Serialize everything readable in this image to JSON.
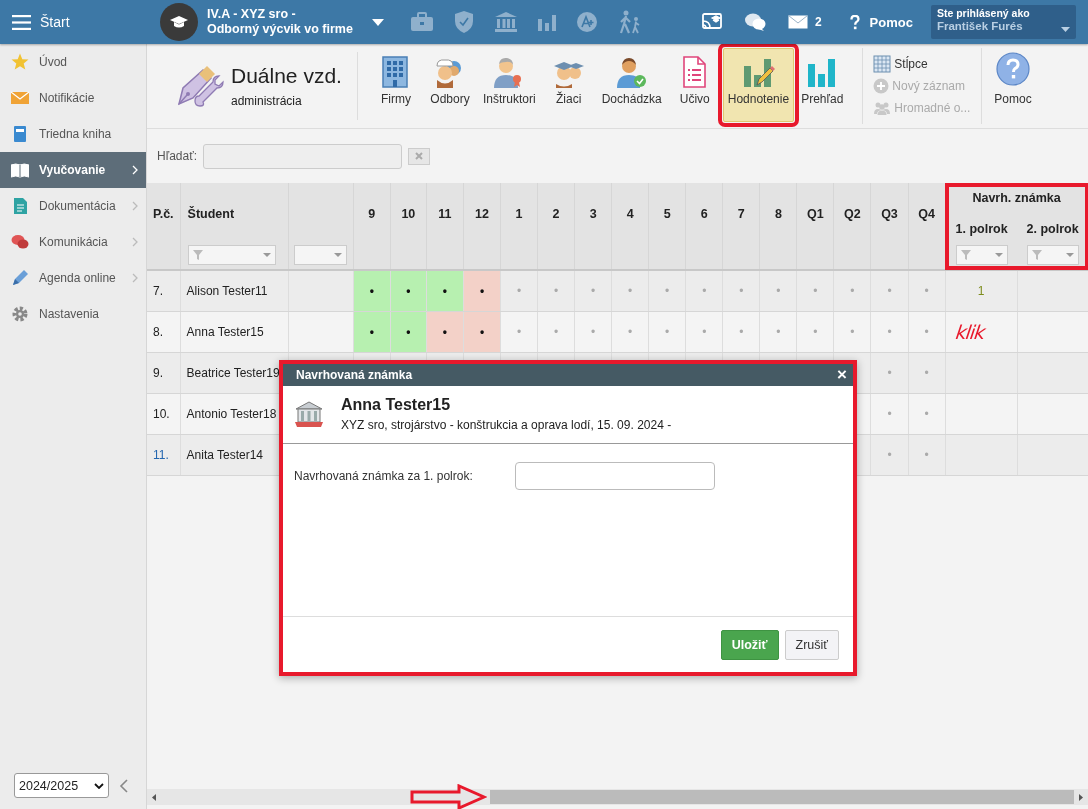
{
  "topbar": {
    "menu_label": "Štart",
    "context_title": "IV.A - XYZ sro -",
    "context_subtitle": "Odborný výcvik vo firme",
    "messages_count": "2",
    "help_label": "Pomoc",
    "user_caption": "Ste prihlásený ako",
    "user_name": "František Furés"
  },
  "sidebar": {
    "items": [
      {
        "label": "Úvod",
        "selected": false,
        "has_submenu": false
      },
      {
        "label": "Notifikácie",
        "selected": false,
        "has_submenu": false
      },
      {
        "label": "Triedna kniha",
        "selected": false,
        "has_submenu": false
      },
      {
        "label": "Vyučovanie",
        "selected": true,
        "has_submenu": true
      },
      {
        "label": "Dokumentácia",
        "selected": false,
        "has_submenu": true
      },
      {
        "label": "Komunikácia",
        "selected": false,
        "has_submenu": true
      },
      {
        "label": "Agenda online",
        "selected": false,
        "has_submenu": true
      },
      {
        "label": "Nastavenia",
        "selected": false,
        "has_submenu": false
      }
    ],
    "year": "2024/2025"
  },
  "module": {
    "title": "Duálne vzd.",
    "subtitle": "administrácia"
  },
  "toolbar": {
    "items": [
      {
        "label": "Firmy",
        "selected": false,
        "highlighted": false
      },
      {
        "label": "Odbory",
        "selected": false,
        "highlighted": false
      },
      {
        "label": "Inštruktori",
        "selected": false,
        "highlighted": false
      },
      {
        "label": "Žiaci",
        "selected": false,
        "highlighted": false
      },
      {
        "label": "Dochádzka",
        "selected": false,
        "highlighted": false
      },
      {
        "label": "Učivo",
        "selected": false,
        "highlighted": false
      },
      {
        "label": "Hodnotenie",
        "selected": true,
        "highlighted": true
      },
      {
        "label": "Prehľad",
        "selected": false,
        "highlighted": false
      }
    ],
    "side_items": [
      {
        "label": "Stĺpce",
        "disabled": false
      },
      {
        "label": "Nový záznam",
        "disabled": true
      },
      {
        "label": "Hromadné o...",
        "disabled": true
      }
    ],
    "help_label": "Pomoc"
  },
  "search": {
    "label": "Hľadať:"
  },
  "table": {
    "number_header": "P.č.",
    "student_header": "Študent",
    "grade_columns": [
      "9",
      "10",
      "11",
      "12",
      "1",
      "2",
      "3",
      "4",
      "5",
      "6",
      "7",
      "8",
      "Q1",
      "Q2",
      "Q3",
      "Q4"
    ],
    "proposal_group": {
      "label": "Navrh. známka",
      "highlighted": true,
      "columns": [
        "1. polrok",
        "2. polrok"
      ]
    },
    "rows": [
      {
        "number": "7.",
        "name": "Alison Tester11",
        "highlighted": false,
        "proposal": "1",
        "cells": [
          {
            "text": "•",
            "kind": "positive"
          },
          {
            "text": "•",
            "kind": "positive"
          },
          {
            "text": "•",
            "kind": "positive"
          },
          {
            "text": "•",
            "kind": "negative"
          },
          {
            "text": "•",
            "kind": "plain"
          },
          {
            "text": "•",
            "kind": "plain"
          },
          {
            "text": "•",
            "kind": "plain"
          },
          {
            "text": "•",
            "kind": "plain"
          },
          {
            "text": "•",
            "kind": "plain"
          },
          {
            "text": "•",
            "kind": "plain"
          },
          {
            "text": "•",
            "kind": "plain"
          },
          {
            "text": "•",
            "kind": "plain"
          },
          {
            "text": "•",
            "kind": "plain"
          },
          {
            "text": "•",
            "kind": "plain"
          },
          {
            "text": "•",
            "kind": "plain"
          },
          {
            "text": "•",
            "kind": "plain"
          }
        ]
      },
      {
        "number": "8.",
        "name": "Anna Tester15",
        "highlighted": false,
        "note": "klik",
        "cells": [
          {
            "text": "•",
            "kind": "positive"
          },
          {
            "text": "•",
            "kind": "positive"
          },
          {
            "text": "•",
            "kind": "negative"
          },
          {
            "text": "•",
            "kind": "negative"
          },
          {
            "text": "•",
            "kind": "plain"
          },
          {
            "text": "•",
            "kind": "plain"
          },
          {
            "text": "•",
            "kind": "plain"
          },
          {
            "text": "•",
            "kind": "plain"
          },
          {
            "text": "•",
            "kind": "plain"
          },
          {
            "text": "•",
            "kind": "plain"
          },
          {
            "text": "•",
            "kind": "plain"
          },
          {
            "text": "•",
            "kind": "plain"
          },
          {
            "text": "•",
            "kind": "plain"
          },
          {
            "text": "•",
            "kind": "plain"
          },
          {
            "text": "•",
            "kind": "plain"
          },
          {
            "text": "•",
            "kind": "plain"
          }
        ]
      },
      {
        "number": "9.",
        "name": "Beatrice Tester19",
        "highlighted": false,
        "cells": [
          null,
          null,
          null,
          null,
          null,
          null,
          null,
          null,
          null,
          null,
          null,
          null,
          null,
          null,
          {
            "text": "•",
            "kind": "plain"
          },
          {
            "text": "•",
            "kind": "plain"
          }
        ]
      },
      {
        "number": "10.",
        "name": "Antonio Tester18",
        "highlighted": false,
        "cells": [
          null,
          null,
          null,
          null,
          null,
          null,
          null,
          null,
          null,
          null,
          null,
          null,
          null,
          null,
          {
            "text": "•",
            "kind": "plain"
          },
          {
            "text": "•",
            "kind": "plain"
          }
        ]
      },
      {
        "number": "11.",
        "name": "Anita Tester14",
        "highlighted": true,
        "cells": [
          null,
          null,
          null,
          null,
          null,
          null,
          null,
          null,
          null,
          null,
          null,
          null,
          null,
          null,
          {
            "text": "•",
            "kind": "plain"
          },
          {
            "text": "•",
            "kind": "plain"
          }
        ]
      }
    ]
  },
  "dialog": {
    "title": "Navrhovaná známka",
    "close": "×",
    "heading": "Anna Tester15",
    "subtitle": "XYZ sro, strojárstvo - konštrukcia a oprava lodí, 15. 09. 2024 -",
    "field_label": "Navrhovaná známka za 1. polrok:",
    "highlighted": true,
    "buttons": [
      {
        "label": "Uložiť",
        "kind": "primary"
      },
      {
        "label": "Zrušiť",
        "kind": "default"
      }
    ]
  },
  "scroll_arrow": true
}
